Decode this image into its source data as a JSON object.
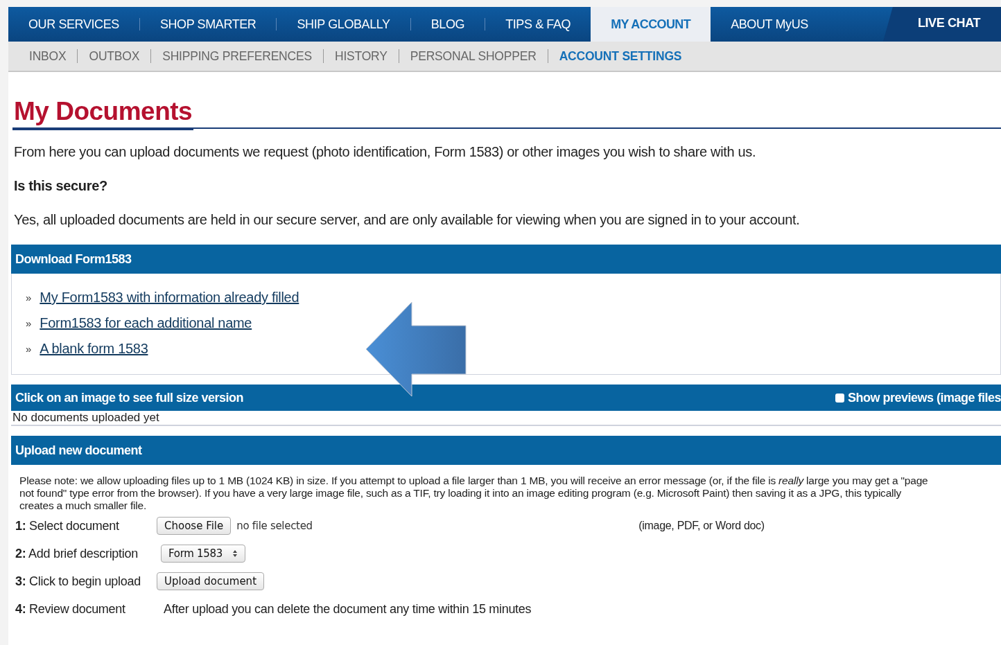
{
  "nav": {
    "items": [
      {
        "label": "OUR SERVICES",
        "selected": false
      },
      {
        "label": "SHOP SMARTER",
        "selected": false
      },
      {
        "label": "SHIP GLOBALLY",
        "selected": false
      },
      {
        "label": "BLOG",
        "selected": false
      },
      {
        "label": "TIPS & FAQ",
        "selected": false
      },
      {
        "label": "MY ACCOUNT",
        "selected": true
      },
      {
        "label": "ABOUT MyUS",
        "selected": false
      }
    ],
    "live_chat": "LIVE CHAT"
  },
  "subnav": [
    {
      "label": "INBOX",
      "selected": false
    },
    {
      "label": "OUTBOX",
      "selected": false
    },
    {
      "label": "SHIPPING PREFERENCES",
      "selected": false
    },
    {
      "label": "HISTORY",
      "selected": false
    },
    {
      "label": "PERSONAL SHOPPER",
      "selected": false
    },
    {
      "label": "ACCOUNT SETTINGS",
      "selected": true
    }
  ],
  "page_title": "My Documents",
  "intro": "From here you can upload documents we request (photo identification, Form 1583) or other images you wish to share with us.",
  "secure_question": "Is this secure?",
  "secure_answer": "Yes, all uploaded documents are held in our secure server, and are only available for viewing when you are signed in to your account.",
  "download": {
    "title": "Download Form1583",
    "links": [
      {
        "bullet": "»",
        "label": "My Form1583 with information already filled"
      },
      {
        "bullet": "»",
        "label": "Form1583 for each additional name"
      },
      {
        "bullet": "»",
        "label": "A blank form 1583"
      }
    ]
  },
  "documents": {
    "title": "Click on an image to see full size version",
    "show_previews": {
      "label": "Show previews (image files",
      "checked": false
    },
    "empty_text": "No documents uploaded yet"
  },
  "upload": {
    "title": "Upload new document",
    "note_lines": [
      "Please note: we allow uploading files up to 1 MB (1024 KB) in size. If you attempt to upload a file larger than 1 MB, you will receive an error message (or, if the file is *really* large you may get a \"page",
      "not found\" type error from the browser). If you have a very large image file, such as a TIF, try loading it into an image editing program (e.g. Microsoft Paint) then saving it as a JPG, this typically",
      "creates a much smaller file."
    ],
    "steps": [
      {
        "kind": "file",
        "label": "**1:** Select document",
        "button": "Choose File",
        "status": "no file selected",
        "hint": "(image, PDF, or Word doc)"
      },
      {
        "kind": "select",
        "label": "**2:** Add brief description",
        "value": "Form 1583"
      },
      {
        "kind": "button",
        "label": "**3:** Click to begin upload",
        "button": "Upload document"
      },
      {
        "kind": "text",
        "label": "**4:** Review document",
        "text": "After upload you can delete the document any time within 15 minutes"
      }
    ]
  }
}
